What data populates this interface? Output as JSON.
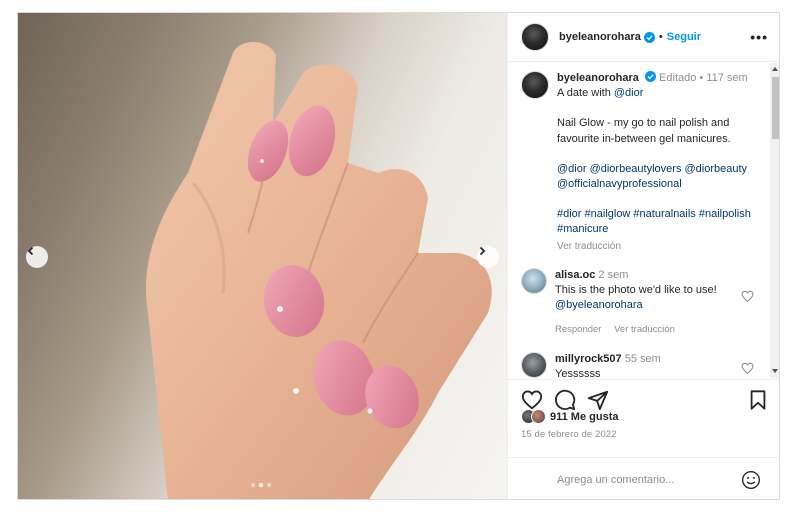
{
  "header": {
    "username": "byeleanorohara",
    "bullet": "•",
    "follow_label": "Seguir",
    "more_label": "•••"
  },
  "caption": {
    "username": "byeleanorohara",
    "meta": "Editado • 117 sem",
    "line1_prefix": "A date with ",
    "line1_mention": "@dior",
    "para2": "Nail Glow - my go to nail polish and favourite in-between gel manicures.",
    "mentions": "@dior @diorbeautylovers @diorbeauty @officialnavyprofessional",
    "hashtags": "#dior #nailglow #naturalnails #nailpolish #manicure",
    "translate": "Ver traducción"
  },
  "comments": [
    {
      "username": "alisa.oc",
      "time": "2 sem",
      "text": "This is the photo we'd like to use!",
      "mention": "@byeleanorohara",
      "reply": "Responder",
      "translate": "Ver traducción"
    },
    {
      "username": "millyrock507",
      "time": "55 sem",
      "text": "Yessssss"
    }
  ],
  "likes_text": "911 Me gusta",
  "date": "15 de febrero de 2022",
  "add_comment": {
    "placeholder": "Agrega un comentario..."
  },
  "carousel": {
    "current": 2,
    "total": 3
  },
  "colors": {
    "accent": "#0095f6",
    "link": "#00376b",
    "muted": "#8e8e8e",
    "nail": "#e28fa3"
  },
  "icons": [
    "chevron-left-icon",
    "chevron-right-icon",
    "verified-badge-icon",
    "heart-icon",
    "comment-icon",
    "share-icon",
    "bookmark-icon",
    "emoji-icon"
  ]
}
